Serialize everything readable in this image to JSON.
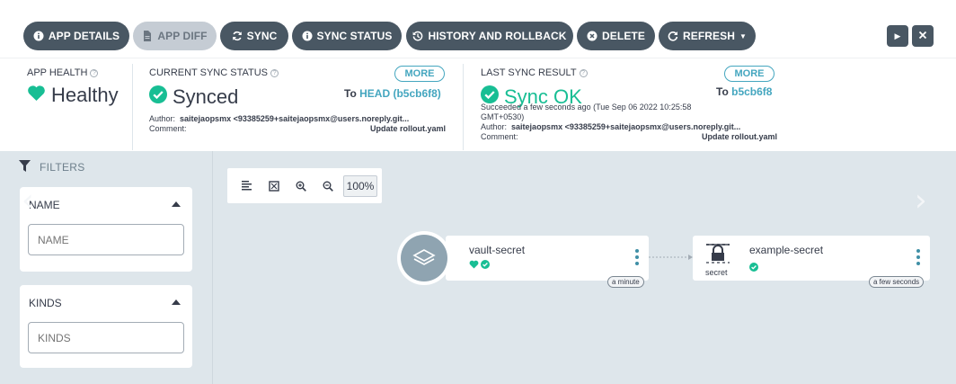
{
  "toolbar": {
    "buttons": [
      {
        "label": "APP DETAILS",
        "icon": "info-circle-icon"
      },
      {
        "label": "APP DIFF",
        "icon": "file-icon"
      },
      {
        "label": "SYNC",
        "icon": "sync-icon"
      },
      {
        "label": "SYNC STATUS",
        "icon": "info-circle-icon"
      },
      {
        "label": "HISTORY AND ROLLBACK",
        "icon": "history-icon"
      },
      {
        "label": "DELETE",
        "icon": "times-circle-icon"
      },
      {
        "label": "REFRESH",
        "icon": "redo-icon"
      }
    ],
    "right_icons": [
      "play-icon",
      "close-icon"
    ],
    "colors": {
      "button_bg": "#495763",
      "disabled_bg": "#c5ccd4"
    }
  },
  "app_health": {
    "title": "APP HEALTH",
    "value": "Healthy",
    "color": "#18be94"
  },
  "current_sync": {
    "title": "CURRENT SYNC STATUS",
    "value": "Synced",
    "more": "MORE",
    "to_label": "To",
    "revision": "HEAD (b5cb6f8)",
    "author_label": "Author:",
    "author": "saitejaopsmx <93385259+saitejaopsmx@users.noreply.git...",
    "comment_label": "Comment:",
    "comment": "Update rollout.yaml"
  },
  "last_sync": {
    "title": "LAST SYNC RESULT",
    "value": "Sync OK",
    "more": "MORE",
    "to_label": "To",
    "revision": "b5cb6f8",
    "succeeded_line1": "Succeeded a few seconds ago (Tue Sep 06 2022 10:25:58",
    "succeeded_line2": "GMT+0530)",
    "author_label": "Author:",
    "author": "saitejaopsmx <93385259+saitejaopsmx@users.noreply.git...",
    "comment_label": "Comment:",
    "comment": "Update rollout.yaml"
  },
  "filters": {
    "title": "FILTERS",
    "name_section": {
      "label": "NAME",
      "placeholder": "NAME"
    },
    "kinds_section": {
      "label": "KINDS",
      "placeholder": "KINDS"
    }
  },
  "graph": {
    "zoom": "100%",
    "tools": [
      "align-left-icon",
      "fit-screen-icon",
      "zoom-in-icon",
      "zoom-out-icon"
    ],
    "nodes": [
      {
        "name": "vault-secret",
        "age": "a minute",
        "icon": "layers-icon"
      },
      {
        "name": "example-secret",
        "kind": "secret",
        "age": "a few seconds",
        "icon": "lock-icon"
      }
    ]
  }
}
